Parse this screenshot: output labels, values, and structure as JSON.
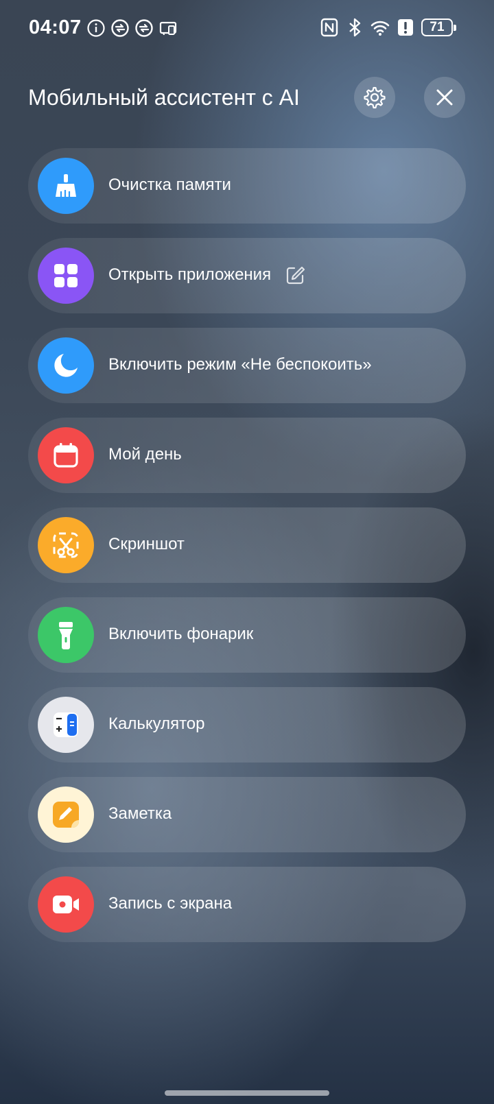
{
  "status_bar": {
    "time": "04:07",
    "battery": "71",
    "left_icons": [
      "info-icon",
      "sync-icon",
      "sync-icon",
      "cast-icon"
    ],
    "right_icons": [
      "nfc-icon",
      "bluetooth-icon",
      "wifi-icon",
      "alert-icon",
      "battery-icon"
    ]
  },
  "header": {
    "title": "Мобильный ассистент с AI",
    "settings_icon": "gear-icon",
    "close_icon": "close-icon"
  },
  "items": [
    {
      "label": "Очистка памяти",
      "icon": "broom-icon",
      "color": "#2f9bfb"
    },
    {
      "label": "Открыть приложения",
      "icon": "apps-grid-icon",
      "color": "#8a55f5",
      "edit_icon": "edit-icon"
    },
    {
      "label": "Включить режим «Не беспокоить»",
      "icon": "moon-icon",
      "color": "#2f9bfb"
    },
    {
      "label": "Мой день",
      "icon": "calendar-icon",
      "color": "#f34a4a"
    },
    {
      "label": "Скриншот",
      "icon": "scissors-icon",
      "color": "#fbab2a"
    },
    {
      "label": "Включить фонарик",
      "icon": "flashlight-icon",
      "color": "#3cc768"
    },
    {
      "label": "Калькулятор",
      "icon": "calculator-icon",
      "color": "#e6e7ec"
    },
    {
      "label": "Заметка",
      "icon": "note-icon",
      "color": "#fff4d6"
    },
    {
      "label": "Запись с экрана",
      "icon": "screen-record-icon",
      "color": "#f34a4a"
    }
  ]
}
